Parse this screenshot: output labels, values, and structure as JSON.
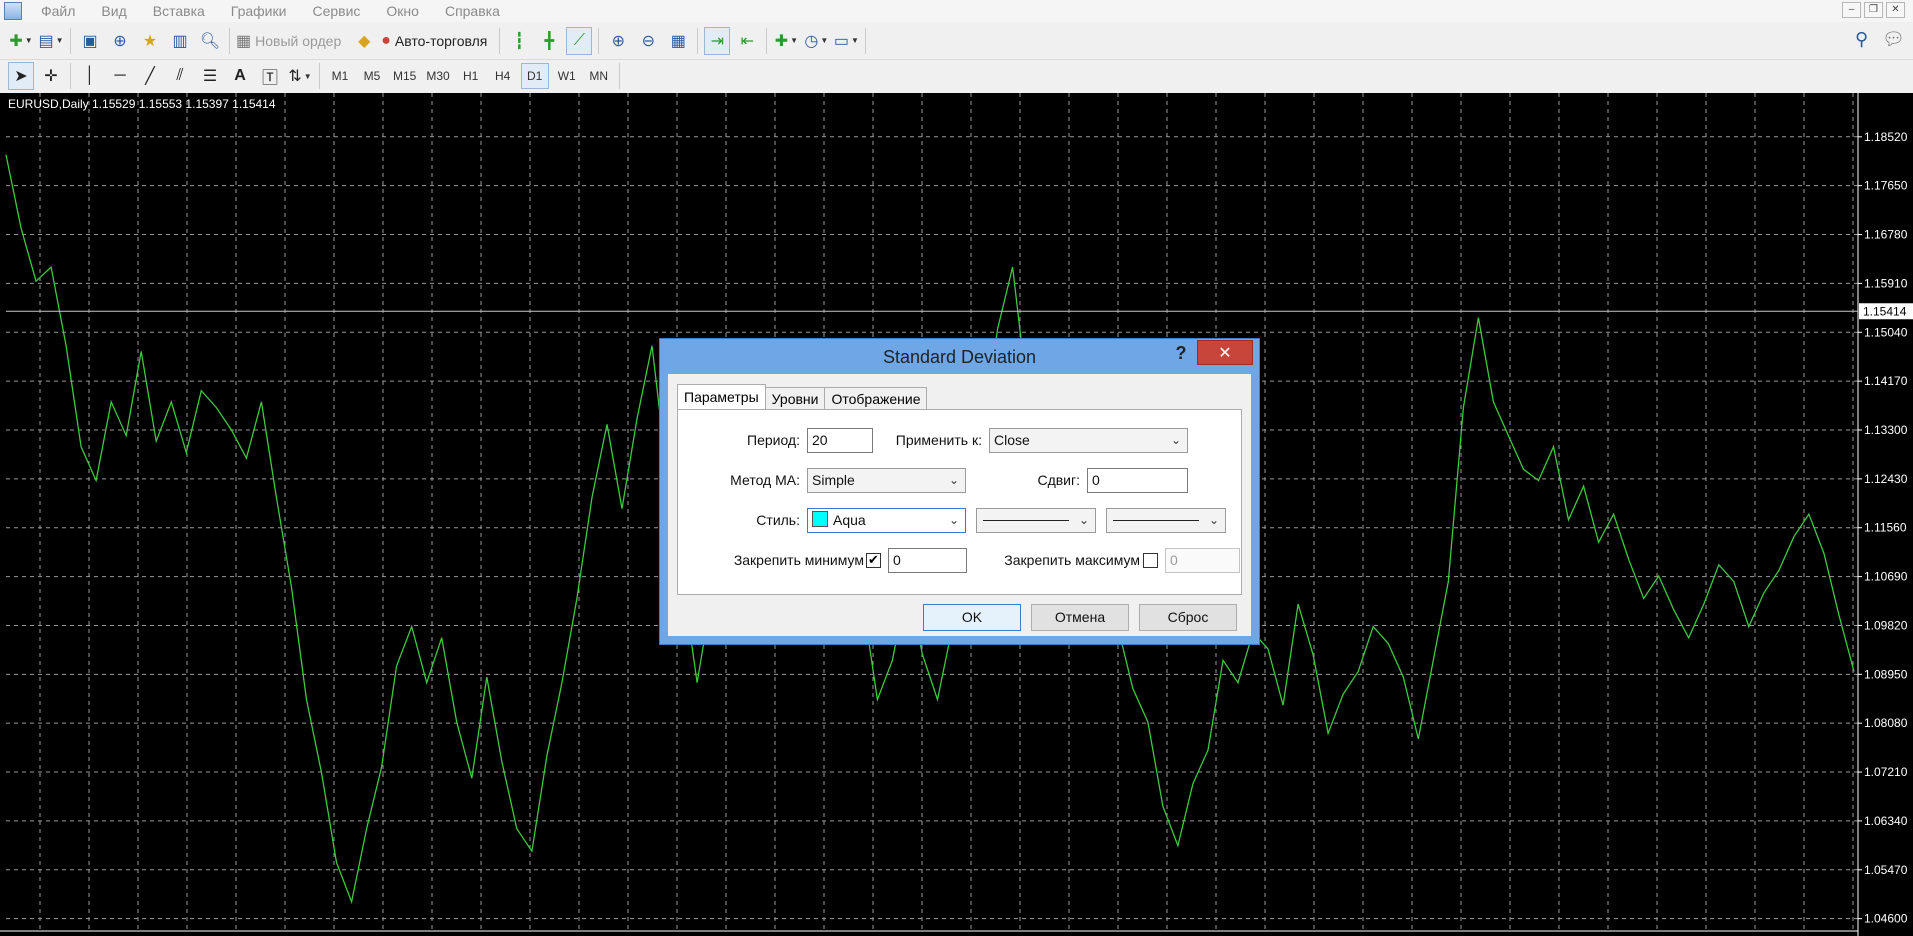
{
  "menu": {
    "items": [
      "Файл",
      "Вид",
      "Вставка",
      "Графики",
      "Сервис",
      "Окно",
      "Справка"
    ]
  },
  "toolbar1": {
    "new_order_label": "Новый ордер",
    "autotrading_label": "Авто-торговля"
  },
  "toolbar2": {
    "timeframes": [
      "M1",
      "M5",
      "M15",
      "M30",
      "H1",
      "H4",
      "D1",
      "W1",
      "MN"
    ],
    "active_timeframe": "D1"
  },
  "chart": {
    "symbol_info": "EURUSD,Daily  1.15529 1.15553 1.15397 1.15414",
    "current_price": "1.15414",
    "line_color": "#3ec93e",
    "grid_color": "#9a9a9a",
    "background": "#000000"
  },
  "chart_data": {
    "type": "line",
    "symbol": "EURUSD",
    "timeframe": "Daily",
    "ohlc": {
      "open": 1.15529,
      "high": 1.15553,
      "low": 1.15397,
      "close": 1.15414
    },
    "price_ticks": [
      "1.18520",
      "1.17650",
      "1.16780",
      "1.15910",
      "1.15040",
      "1.14170",
      "1.13300",
      "1.12430",
      "1.11560",
      "1.10690",
      "1.09820",
      "1.08950",
      "1.08080",
      "1.07210",
      "1.06340",
      "1.05470",
      "1.04600"
    ],
    "ylim": [
      1.0438,
      1.193
    ],
    "grid": true,
    "values": [
      1.182,
      1.169,
      1.1595,
      1.162,
      1.148,
      1.13,
      1.124,
      1.138,
      1.132,
      1.147,
      1.131,
      1.138,
      1.129,
      1.14,
      1.137,
      1.133,
      1.128,
      1.138,
      1.121,
      1.105,
      1.085,
      1.072,
      1.056,
      1.049,
      1.062,
      1.073,
      1.091,
      1.098,
      1.088,
      1.096,
      1.081,
      1.071,
      1.089,
      1.074,
      1.062,
      1.058,
      1.075,
      1.088,
      1.103,
      1.121,
      1.134,
      1.119,
      1.135,
      1.148,
      1.125,
      1.107,
      1.088,
      1.104,
      1.123,
      1.131,
      1.12,
      1.135,
      1.127,
      1.115,
      1.121,
      1.108,
      1.097,
      1.103,
      1.085,
      1.092,
      1.106,
      1.093,
      1.085,
      1.098,
      1.117,
      1.132,
      1.151,
      1.162,
      1.139,
      1.124,
      1.122,
      1.115,
      1.104,
      1.111,
      1.098,
      1.087,
      1.081,
      1.066,
      1.059,
      1.07,
      1.076,
      1.092,
      1.088,
      1.097,
      1.094,
      1.084,
      1.102,
      1.093,
      1.079,
      1.086,
      1.09,
      1.098,
      1.095,
      1.089,
      1.078,
      1.092,
      1.106,
      1.137,
      1.153,
      1.138,
      1.132,
      1.126,
      1.124,
      1.13,
      1.117,
      1.123,
      1.113,
      1.118,
      1.11,
      1.103,
      1.107,
      1.101,
      1.096,
      1.102,
      1.109,
      1.106,
      1.098,
      1.104,
      1.108,
      1.114,
      1.118,
      1.111,
      1.1,
      1.09
    ]
  },
  "dialog": {
    "title": "Standard Deviation",
    "help_label": "?",
    "close_label": "✕",
    "tabs": [
      "Параметры",
      "Уровни",
      "Отображение"
    ],
    "active_tab": "Параметры",
    "period_label": "Период:",
    "period_value": "20",
    "apply_to_label": "Применить к:",
    "apply_to_value": "Close",
    "ma_method_label": "Метод МА:",
    "ma_method_value": "Simple",
    "shift_label": "Сдвиг:",
    "shift_value": "0",
    "style_label": "Стиль:",
    "style_color_name": "Aqua",
    "style_color": "#00ffff",
    "fix_min_label": "Закрепить минимум",
    "fix_min_checked": true,
    "fix_min_value": "0",
    "fix_max_label": "Закрепить максимум",
    "fix_max_checked": false,
    "fix_max_value": "0",
    "ok_label": "OK",
    "cancel_label": "Отмена",
    "reset_label": "Сброс"
  }
}
